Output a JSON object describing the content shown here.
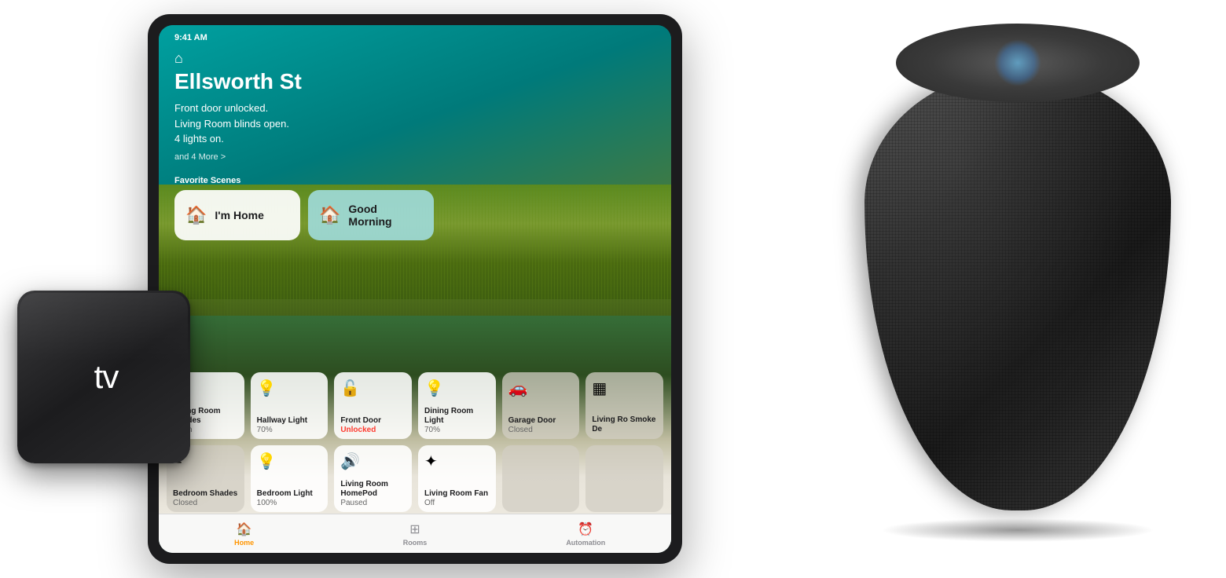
{
  "ipad": {
    "status_bar": {
      "time": "9:41 AM"
    },
    "home": {
      "location": "Ellsworth St",
      "subtitle_line1": "Front door unlocked.",
      "subtitle_line2": "Living Room blinds open.",
      "subtitle_line3": "4 lights on.",
      "more": "and 4 More >"
    },
    "scenes": {
      "label": "Favorite Scenes",
      "items": [
        {
          "id": "im-home",
          "name": "I'm Home",
          "icon": "🏠",
          "active": false
        },
        {
          "id": "good-morning",
          "name": "Good Morning",
          "icon": "🏠",
          "active": true
        }
      ]
    },
    "accessories": [
      [
        {
          "id": "living-room-shades",
          "name": "Living Room Shades",
          "status": "Open",
          "icon": "≡",
          "dimmed": false
        },
        {
          "id": "hallway-light",
          "name": "Hallway Light",
          "status": "70%",
          "icon": "💡",
          "dimmed": false
        },
        {
          "id": "front-door",
          "name": "Front Door",
          "status": "Unlocked",
          "icon": "🔓",
          "dimmed": false,
          "statusClass": "unlocked"
        },
        {
          "id": "dining-room-light",
          "name": "Dining Room Light",
          "status": "70%",
          "icon": "💡",
          "dimmed": false
        },
        {
          "id": "garage-door",
          "name": "Garage Door Closed",
          "status": "Closed",
          "icon": "🚪",
          "dimmed": true
        },
        {
          "id": "smoke-detector",
          "name": "Living Room Smoke De",
          "status": "",
          "icon": "▦",
          "dimmed": true
        }
      ],
      [
        {
          "id": "bedroom-shades",
          "name": "Bedroom Shades",
          "status": "Closed",
          "icon": "≡",
          "dimmed": true
        },
        {
          "id": "bedroom-light",
          "name": "Bedroom Light",
          "status": "100%",
          "icon": "💡",
          "dimmed": false
        },
        {
          "id": "homepod",
          "name": "Living Room HomePod",
          "status": "Paused",
          "icon": "🔊",
          "dimmed": false
        },
        {
          "id": "fan",
          "name": "Living Room Fan",
          "status": "Off",
          "icon": "✦",
          "dimmed": false
        },
        {
          "id": "empty1",
          "name": "",
          "status": "",
          "icon": "",
          "dimmed": true
        },
        {
          "id": "empty2",
          "name": "",
          "status": "",
          "icon": "",
          "dimmed": true
        }
      ]
    ],
    "tabs": [
      {
        "id": "home",
        "label": "Home",
        "icon": "🏠",
        "active": true
      },
      {
        "id": "rooms",
        "label": "Rooms",
        "icon": "⊞",
        "active": false
      },
      {
        "id": "automation",
        "label": "Automation",
        "icon": "⏰",
        "active": false
      }
    ]
  },
  "appletv": {
    "logo_symbol": "",
    "logo_text": "tv"
  },
  "homepod": {
    "label": "HomePod"
  }
}
